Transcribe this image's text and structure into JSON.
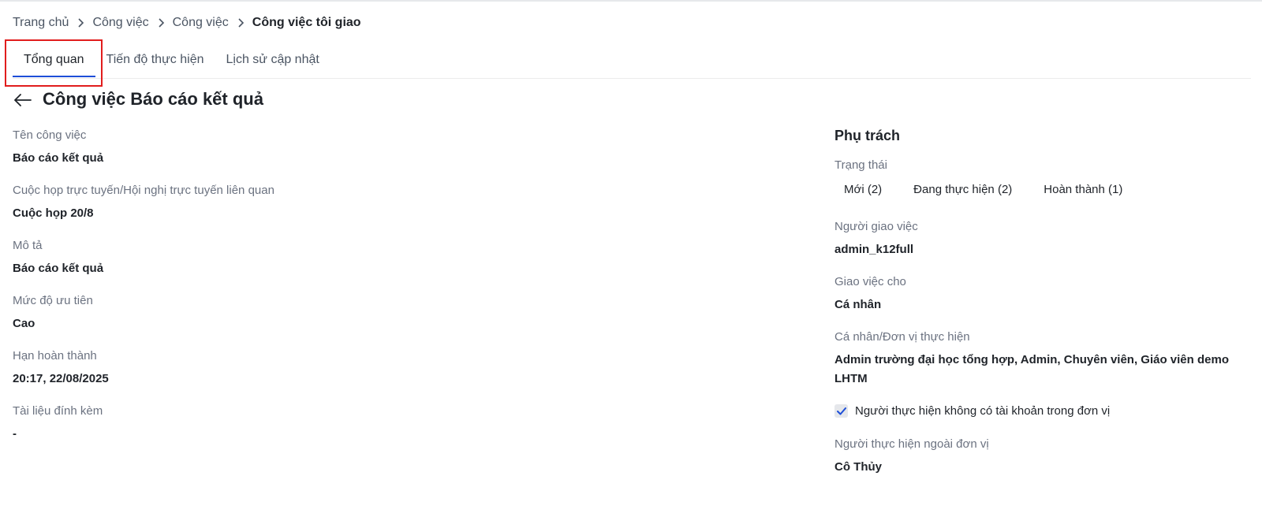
{
  "breadcrumb": {
    "items": [
      "Trang chủ",
      "Công việc",
      "Công việc"
    ],
    "current": "Công việc tôi giao"
  },
  "tabs": [
    {
      "label": "Tổng quan",
      "active": true
    },
    {
      "label": "Tiến độ thực hiện",
      "active": false
    },
    {
      "label": "Lịch sử cập nhật",
      "active": false
    }
  ],
  "page": {
    "title": "Công việc Báo cáo kết quả"
  },
  "left": {
    "task_name": {
      "label": "Tên công việc",
      "value": "Báo cáo kết quả"
    },
    "meeting": {
      "label": "Cuộc họp trực tuyến/Hội nghị trực tuyến liên quan",
      "value": "Cuộc họp 20/8"
    },
    "description": {
      "label": "Mô tả",
      "value": "Báo cáo kết quả"
    },
    "priority": {
      "label": "Mức độ ưu tiên",
      "value": "Cao"
    },
    "deadline": {
      "label": "Hạn hoàn thành",
      "value": "20:17, 22/08/2025"
    },
    "attachments": {
      "label": "Tài liệu đính kèm",
      "value": "-"
    }
  },
  "right": {
    "section_title": "Phụ trách",
    "status": {
      "label": "Trạng thái",
      "items": [
        "Mới (2)",
        "Đang thực hiện (2)",
        "Hoàn thành (1)"
      ]
    },
    "assigner": {
      "label": "Người giao việc",
      "value": "admin_k12full"
    },
    "assign_to": {
      "label": "Giao việc cho",
      "value": "Cá nhân"
    },
    "executors": {
      "label": "Cá nhân/Đơn vị thực hiện",
      "value": "Admin trường đại học tổng hợp, Admin, Chuyên viên, Giáo viên demo LHTM"
    },
    "no_account_checkbox": {
      "label": "Người thực hiện không có tài khoản trong đơn vị",
      "checked": true
    },
    "external": {
      "label": "Người thực hiện ngoài đơn vị",
      "value": "Cô Thủy"
    }
  },
  "colors": {
    "accent": "#1d4ed8",
    "highlight": "#e11d1d",
    "label": "#6b7280",
    "text": "#1f2329"
  }
}
